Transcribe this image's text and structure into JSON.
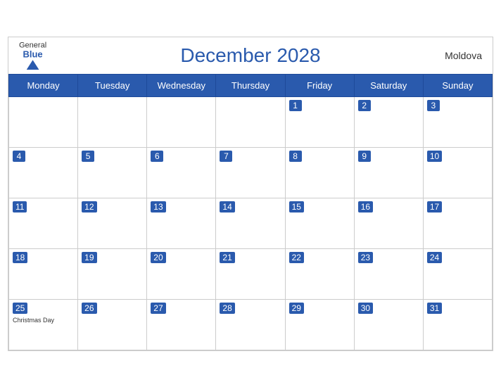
{
  "header": {
    "title": "December 2028",
    "country": "Moldova",
    "logo_general": "General",
    "logo_blue": "Blue"
  },
  "weekdays": [
    "Monday",
    "Tuesday",
    "Wednesday",
    "Thursday",
    "Friday",
    "Saturday",
    "Sunday"
  ],
  "weeks": [
    [
      {
        "day": null,
        "holiday": ""
      },
      {
        "day": null,
        "holiday": ""
      },
      {
        "day": null,
        "holiday": ""
      },
      {
        "day": null,
        "holiday": ""
      },
      {
        "day": 1,
        "holiday": ""
      },
      {
        "day": 2,
        "holiday": ""
      },
      {
        "day": 3,
        "holiday": ""
      }
    ],
    [
      {
        "day": 4,
        "holiday": ""
      },
      {
        "day": 5,
        "holiday": ""
      },
      {
        "day": 6,
        "holiday": ""
      },
      {
        "day": 7,
        "holiday": ""
      },
      {
        "day": 8,
        "holiday": ""
      },
      {
        "day": 9,
        "holiday": ""
      },
      {
        "day": 10,
        "holiday": ""
      }
    ],
    [
      {
        "day": 11,
        "holiday": ""
      },
      {
        "day": 12,
        "holiday": ""
      },
      {
        "day": 13,
        "holiday": ""
      },
      {
        "day": 14,
        "holiday": ""
      },
      {
        "day": 15,
        "holiday": ""
      },
      {
        "day": 16,
        "holiday": ""
      },
      {
        "day": 17,
        "holiday": ""
      }
    ],
    [
      {
        "day": 18,
        "holiday": ""
      },
      {
        "day": 19,
        "holiday": ""
      },
      {
        "day": 20,
        "holiday": ""
      },
      {
        "day": 21,
        "holiday": ""
      },
      {
        "day": 22,
        "holiday": ""
      },
      {
        "day": 23,
        "holiday": ""
      },
      {
        "day": 24,
        "holiday": ""
      }
    ],
    [
      {
        "day": 25,
        "holiday": "Christmas Day"
      },
      {
        "day": 26,
        "holiday": ""
      },
      {
        "day": 27,
        "holiday": ""
      },
      {
        "day": 28,
        "holiday": ""
      },
      {
        "day": 29,
        "holiday": ""
      },
      {
        "day": 30,
        "holiday": ""
      },
      {
        "day": 31,
        "holiday": ""
      }
    ]
  ]
}
